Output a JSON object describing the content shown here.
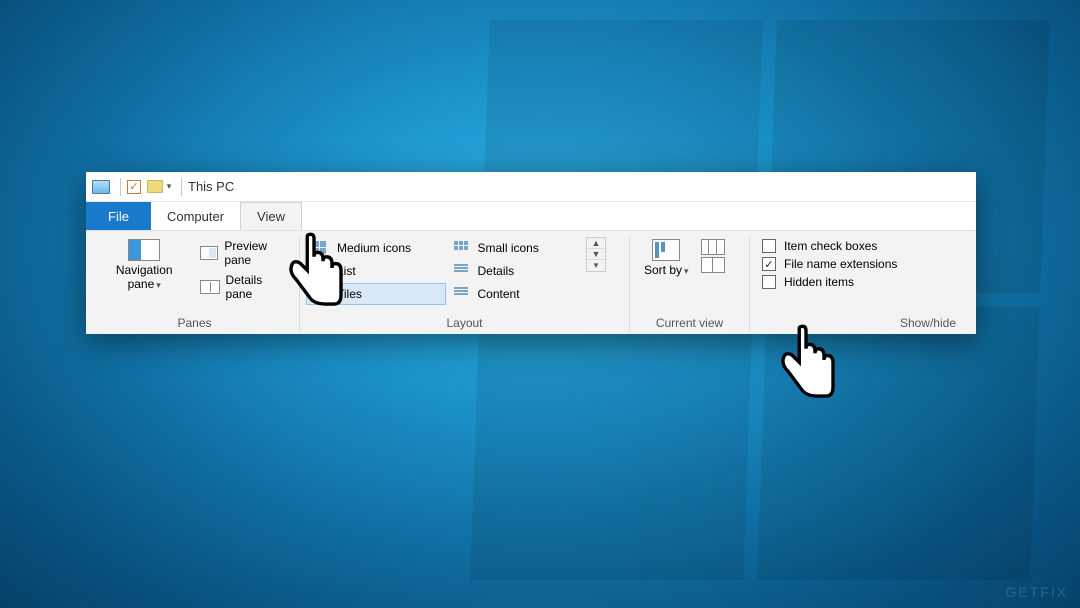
{
  "window": {
    "title": "This PC"
  },
  "tabs": {
    "file": "File",
    "computer": "Computer",
    "view": "View"
  },
  "panes": {
    "navigation": "Navigation pane",
    "preview": "Preview pane",
    "details": "Details pane",
    "group_label": "Panes"
  },
  "layout": {
    "items": {
      "medium": "Medium icons",
      "small": "Small icons",
      "list": "List",
      "details": "Details",
      "tiles": "Tiles",
      "content": "Content"
    },
    "group_label": "Layout"
  },
  "current_view": {
    "sort": "Sort by",
    "group_label": "Current view"
  },
  "show_hide": {
    "item_check_boxes": "Item check boxes",
    "file_name_extensions": "File name extensions",
    "hidden_items": "Hidden items",
    "group_label": "Show/hide"
  },
  "watermark": "GETFIX"
}
